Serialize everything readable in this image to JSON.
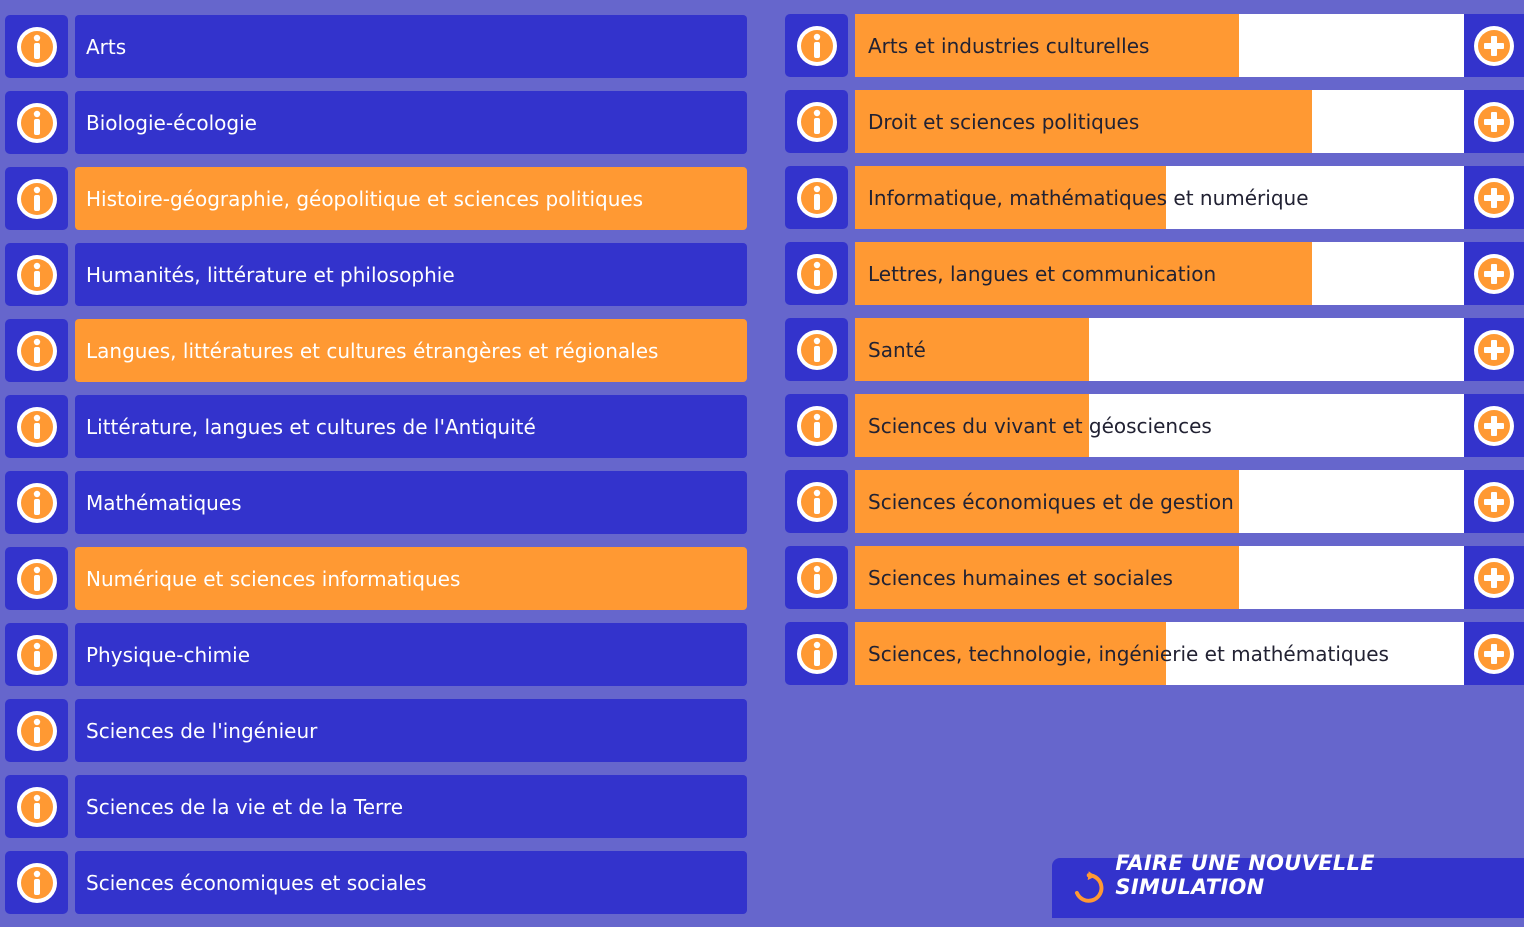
{
  "colors": {
    "background": "#6666cc",
    "tile": "#3333cc",
    "selected": "#ff9933",
    "bar_bg": "#ffffff"
  },
  "specialties": [
    {
      "label": "Arts",
      "selected": false
    },
    {
      "label": "Biologie-écologie",
      "selected": false
    },
    {
      "label": "Histoire-géographie, géopolitique et sciences politiques",
      "selected": true
    },
    {
      "label": "Humanités, littérature et philosophie",
      "selected": false
    },
    {
      "label": "Langues, littératures et cultures étrangères et régionales",
      "selected": true
    },
    {
      "label": "Littérature, langues et cultures de l'Antiquité",
      "selected": false
    },
    {
      "label": "Mathématiques",
      "selected": false
    },
    {
      "label": "Numérique et sciences informatiques",
      "selected": true
    },
    {
      "label": "Physique-chimie",
      "selected": false
    },
    {
      "label": "Sciences de l'ingénieur",
      "selected": false
    },
    {
      "label": "Sciences de la vie et de la Terre",
      "selected": false
    },
    {
      "label": "Sciences économiques et sociales",
      "selected": false
    }
  ],
  "domains": [
    {
      "label": "Arts et industries culturelles",
      "level": 0.63
    },
    {
      "label": "Droit et sciences politiques",
      "level": 0.75
    },
    {
      "label": "Informatique, mathématiques et numérique",
      "level": 0.51
    },
    {
      "label": "Lettres, langues et communication",
      "level": 0.75
    },
    {
      "label": "Santé",
      "level": 0.385
    },
    {
      "label": "Sciences du vivant et géosciences",
      "level": 0.385
    },
    {
      "label": "Sciences économiques et de gestion",
      "level": 0.63
    },
    {
      "label": "Sciences humaines et sociales",
      "level": 0.63
    },
    {
      "label": "Sciences, technologie, ingénierie et mathématiques",
      "level": 0.51
    }
  ],
  "icons": {
    "info": "info-icon",
    "add": "plus-icon",
    "refresh": "refresh-icon"
  },
  "new_simulation_label": "FAIRE UNE NOUVELLE SIMULATION"
}
